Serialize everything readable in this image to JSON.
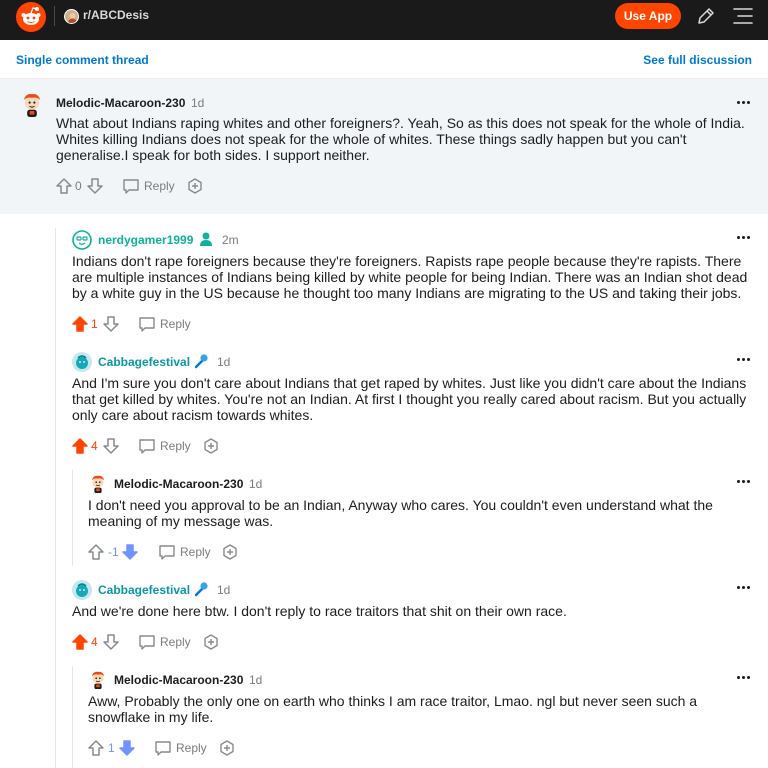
{
  "header": {
    "subreddit": "r/ABCDesis",
    "use_app_label": "Use App",
    "colors": {
      "bar": "#1a1a1b",
      "brand": "#ff4500"
    }
  },
  "thread": {
    "single_thread_label": "Single comment thread",
    "full_discussion_label": "See full discussion"
  },
  "comments": [
    {
      "author": "Melodic-Macaroon-230",
      "age": "1d",
      "body": "What about Indians raping whites and other foreigners?. Yeah, So as this does not speak for the whole of India. Whites killing Indians does not speak for the whole of whites. These things sadly happen but you can't generalise.I speak for both sides. I support neither.",
      "score": "0",
      "reply_label": "Reply",
      "vote": "none"
    },
    {
      "author": "nerdygamer1999",
      "age": "2m",
      "body": "Indians don't rape foreigners because they're foreigners. Rapists rape people because they're rapists. There are multiple instances of Indians being killed by white people for being Indian. There was an Indian shot dead by a white guy in the US because he thought too many Indians are migrating to the US and taking their jobs.",
      "score": "1",
      "reply_label": "Reply",
      "vote": "up"
    },
    {
      "author": "Cabbagefestival",
      "age": "1d",
      "body": "And I'm sure you don't care about Indians that get raped by whites. Just like you didn't care about the Indians that get killed by whites. You're not an Indian. At first I thought you really cared about racism. But you actually only care about racism towards whites.",
      "score": "4",
      "reply_label": "Reply",
      "vote": "up"
    },
    {
      "author": "Melodic-Macaroon-230",
      "age": "1d",
      "body": "I don't need you approval to be an Indian, Anyway who cares. You couldn't even understand what the meaning of my message was.",
      "score": "-1",
      "reply_label": "Reply",
      "vote": "down"
    },
    {
      "author": "Cabbagefestival",
      "age": "1d",
      "body": "And we're done here btw. I don't reply to race traitors that shit on their own race.",
      "score": "4",
      "reply_label": "Reply",
      "vote": "up"
    },
    {
      "author": "Melodic-Macaroon-230",
      "age": "1d",
      "body": "Aww, Probably the only one on earth who thinks I am race traitor, Lmao. ngl but never seen such a snowflake in my life.",
      "score": "1",
      "reply_label": "Reply",
      "vote": "down"
    }
  ],
  "icons": {
    "logo": "reddit-logo-icon",
    "edit": "pencil-icon",
    "menu": "hamburger-menu-icon",
    "more": "more-options-icon",
    "upvote": "upvote-arrow-icon",
    "downvote": "downvote-arrow-icon",
    "reply": "comment-bubble-icon",
    "award": "award-icon",
    "flair_user": "person-flair-icon",
    "flair_mic": "microphone-flair-icon"
  }
}
